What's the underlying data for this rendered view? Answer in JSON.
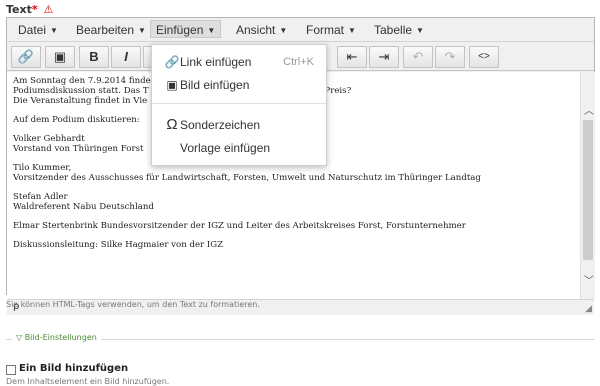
{
  "field": {
    "label": "Text",
    "required_mark": "*",
    "warning_icon": "warning-triangle-icon"
  },
  "menubar": {
    "items": [
      {
        "label": "Datei"
      },
      {
        "label": "Bearbeiten"
      },
      {
        "label": "Einfügen"
      },
      {
        "label": "Ansicht"
      },
      {
        "label": "Format"
      },
      {
        "label": "Tabelle"
      }
    ],
    "active": "Einfügen"
  },
  "toolbar": {
    "buttons": [
      {
        "name": "link-icon",
        "glyph": "🔗"
      },
      {
        "name": "image-icon",
        "glyph": "▣"
      },
      {
        "name": "bold-button",
        "glyph": "B"
      },
      {
        "name": "italic-button",
        "glyph": "I"
      },
      {
        "name": "align-icon",
        "glyph": "≣"
      },
      {
        "name": "outdent-icon",
        "glyph": "⇤"
      },
      {
        "name": "indent-icon",
        "glyph": "⇥"
      },
      {
        "name": "undo-icon",
        "glyph": "↶"
      },
      {
        "name": "redo-icon",
        "glyph": "↷"
      },
      {
        "name": "source-code-icon",
        "glyph": "<>"
      }
    ]
  },
  "dropdown": {
    "items": [
      {
        "icon": "link-icon",
        "glyph": "🔗",
        "label": "Link einfügen",
        "shortcut": "Ctrl+K"
      },
      {
        "icon": "image-icon",
        "glyph": "▣",
        "label": "Bild einfügen",
        "shortcut": ""
      },
      {
        "icon": "omega-icon",
        "glyph": "Ω",
        "label": "Sonderzeichen",
        "shortcut": ""
      },
      {
        "icon": "",
        "glyph": "",
        "label": "Vorlage einfügen",
        "shortcut": ""
      }
    ]
  },
  "content": {
    "paragraphs": [
      "Am Sonntag den 7.9.2014 finde                                                         rmeisterschaften im Pferderücken eine\nPodiumsdiskussion statt. Das T                                                          Einsatz von Rückepferden - stimmt der Preis?\nDie Veranstaltung findet in Vie",
      "Auf dem Podium diskutieren:",
      "Volker Gebhardt\nVorstand von Thüringen Forst",
      "Tilo Kummer,\nVorsitzender des Ausschusses für Landwirtschaft, Forsten, Umwelt und Naturschutz im Thüringer Landtag",
      "Stefan Adler\nWaldreferent Nabu Deutschland",
      "Elmar Stertenbrink Bundesvorsitzender der IGZ und Leiter des Arbeitskreises Forst, Forstunternehmer",
      "Diskussionsleitung: Silke Hagmaier von der IGZ"
    ]
  },
  "statusbar": {
    "path": "p"
  },
  "hint": "Sie können HTML-Tags verwenden, um den Text zu formatieren.",
  "image_settings": {
    "legend": "▽ Bild-Einstellungen",
    "checkbox_label": "Ein Bild hinzufügen",
    "checkbox_hint": "Dem Inhaltselement ein Bild hinzufügen.",
    "checked": false
  }
}
